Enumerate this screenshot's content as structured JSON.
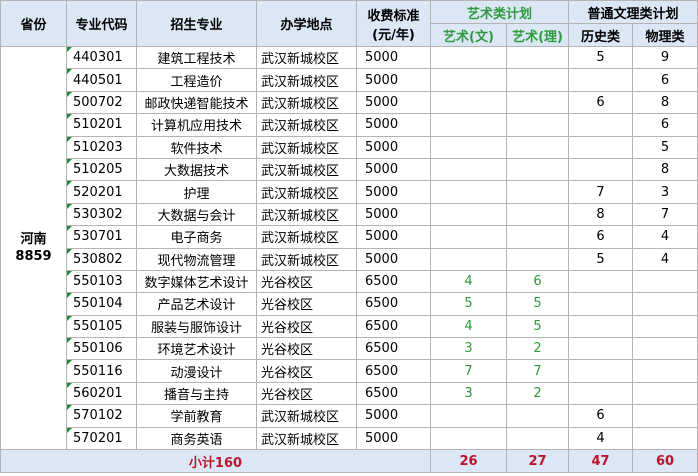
{
  "header": {
    "province": "省份",
    "code": "专业代码",
    "major": "招生专业",
    "campus": "办学地点",
    "fee": "收费标准\n(元/年)",
    "fee_line1": "收费标准",
    "fee_line2": "(元/年)",
    "art_plan": "艺术类计划",
    "art_liberal": "艺术(文)",
    "art_science": "艺术(理)",
    "general_plan": "普通文理类计划",
    "history": "历史类",
    "physics": "物理类"
  },
  "province": {
    "name": "河南",
    "count": "8859"
  },
  "rows": [
    {
      "code": "440301",
      "major": "建筑工程技术",
      "campus": "武汉新城校区",
      "fee": "5000",
      "art_liberal": "",
      "art_science": "",
      "history": "5",
      "physics": "9"
    },
    {
      "code": "440501",
      "major": "工程造价",
      "campus": "武汉新城校区",
      "fee": "5000",
      "art_liberal": "",
      "art_science": "",
      "history": "",
      "physics": "6"
    },
    {
      "code": "500702",
      "major": "邮政快递智能技术",
      "campus": "武汉新城校区",
      "fee": "5000",
      "art_liberal": "",
      "art_science": "",
      "history": "6",
      "physics": "8"
    },
    {
      "code": "510201",
      "major": "计算机应用技术",
      "campus": "武汉新城校区",
      "fee": "5000",
      "art_liberal": "",
      "art_science": "",
      "history": "",
      "physics": "6"
    },
    {
      "code": "510203",
      "major": "软件技术",
      "campus": "武汉新城校区",
      "fee": "5000",
      "art_liberal": "",
      "art_science": "",
      "history": "",
      "physics": "5"
    },
    {
      "code": "510205",
      "major": "大数据技术",
      "campus": "武汉新城校区",
      "fee": "5000",
      "art_liberal": "",
      "art_science": "",
      "history": "",
      "physics": "8"
    },
    {
      "code": "520201",
      "major": "护理",
      "campus": "武汉新城校区",
      "fee": "5000",
      "art_liberal": "",
      "art_science": "",
      "history": "7",
      "physics": "3"
    },
    {
      "code": "530302",
      "major": "大数据与会计",
      "campus": "武汉新城校区",
      "fee": "5000",
      "art_liberal": "",
      "art_science": "",
      "history": "8",
      "physics": "7"
    },
    {
      "code": "530701",
      "major": "电子商务",
      "campus": "武汉新城校区",
      "fee": "5000",
      "art_liberal": "",
      "art_science": "",
      "history": "6",
      "physics": "4"
    },
    {
      "code": "530802",
      "major": "现代物流管理",
      "campus": "武汉新城校区",
      "fee": "5000",
      "art_liberal": "",
      "art_science": "",
      "history": "5",
      "physics": "4"
    },
    {
      "code": "550103",
      "major": "数字媒体艺术设计",
      "campus": "光谷校区",
      "fee": "6500",
      "art_liberal": "4",
      "art_science": "6",
      "history": "",
      "physics": ""
    },
    {
      "code": "550104",
      "major": "产品艺术设计",
      "campus": "光谷校区",
      "fee": "6500",
      "art_liberal": "5",
      "art_science": "5",
      "history": "",
      "physics": ""
    },
    {
      "code": "550105",
      "major": "服装与服饰设计",
      "campus": "光谷校区",
      "fee": "6500",
      "art_liberal": "4",
      "art_science": "5",
      "history": "",
      "physics": ""
    },
    {
      "code": "550106",
      "major": "环境艺术设计",
      "campus": "光谷校区",
      "fee": "6500",
      "art_liberal": "3",
      "art_science": "2",
      "history": "",
      "physics": ""
    },
    {
      "code": "550116",
      "major": "动漫设计",
      "campus": "光谷校区",
      "fee": "6500",
      "art_liberal": "7",
      "art_science": "7",
      "history": "",
      "physics": ""
    },
    {
      "code": "560201",
      "major": "播音与主持",
      "campus": "光谷校区",
      "fee": "6500",
      "art_liberal": "3",
      "art_science": "2",
      "history": "",
      "physics": ""
    },
    {
      "code": "570102",
      "major": "学前教育",
      "campus": "武汉新城校区",
      "fee": "5000",
      "art_liberal": "",
      "art_science": "",
      "history": "6",
      "physics": ""
    },
    {
      "code": "570201",
      "major": "商务英语",
      "campus": "武汉新城校区",
      "fee": "5000",
      "art_liberal": "",
      "art_science": "",
      "history": "4",
      "physics": ""
    }
  ],
  "footer": {
    "subtotal_label": "小计160",
    "art_liberal": "26",
    "art_science": "27",
    "history": "47",
    "physics": "60"
  },
  "colors": {
    "header_bg": "#dbe7f5",
    "art_green": "#2e9b3c",
    "total_red": "#c0122c",
    "border": "#b4b4b4"
  }
}
